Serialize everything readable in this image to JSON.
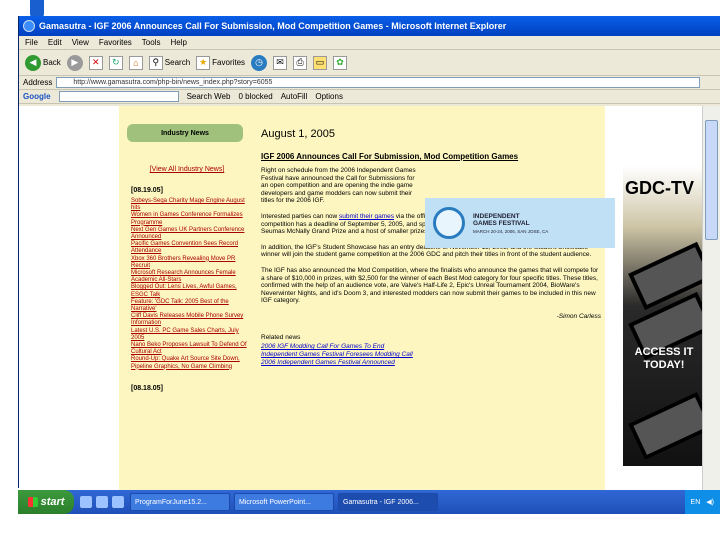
{
  "window": {
    "title": "Gamasutra - IGF 2006 Announces Call For Submission, Mod Competition Games - Microsoft Internet Explorer"
  },
  "menu": [
    "File",
    "Edit",
    "View",
    "Favorites",
    "Tools",
    "Help"
  ],
  "toolbar": {
    "back": "Back",
    "search": "Search",
    "favorites": "Favorites"
  },
  "address": {
    "label": "Address",
    "value": "http://www.gamasutra.com/php-bin/news_index.php?story=6055"
  },
  "google": {
    "logo": "Google",
    "search_web": "Search Web",
    "blocked": "0 blocked",
    "autofill": "AutoFill",
    "options": "Options"
  },
  "sidebar": {
    "title": "Industry News",
    "view_all": "[View All Industry News]",
    "date1": "[08.19.05]",
    "items": [
      "Sobeys-Sega Charity Mage Engine August hits",
      "Women in Games Conference Formalizes Programme",
      "Next Gen Games UK Partners Conference Announced",
      "Pacific Games Convention Sees Record Attendance",
      "Xbox 360 Brothers Revealing Move PR Recruit",
      "Microsoft Research Announces Female Academic All-Stars",
      "Blogged Out: Lens Lives, Awful Games, ESGC Talk",
      "Feature: 'GDC Talk: 2005 Best of the Narrative'",
      "Cliff Davis Releases Mobile Phone Survey Information",
      "Latest U.S. PC Game Sales Charts, July 2005",
      "Nano Beko Proposes Lawsuit To Defend Of Cultural Act",
      "Round-Up: Quake Art Source Site Down, Pipeline Graphics, No Game Climbing"
    ],
    "date2": "[08.18.05]"
  },
  "article": {
    "date": "August 1, 2005",
    "headline": "IGF 2006 Announces Call For Submission, Mod Competition Games",
    "para1": "Right on schedule from the 2006 Independent Games Festival have announced the Call for Submissions for an open competition and are opening the indie game developers and game modders can now submit their titles for the 2006 IGF.",
    "para2a": "Interested parties can now ",
    "para2link": "submit their games",
    "para2b": " via the official Independent Games Festival site. The main IGF competition has a deadline of September 5, 2005, and sports a total prize pool of $50,000, including the $20,000 Seumas McNally Grand Prize and a host of smaller prizes.",
    "para3": "In addition, the IGF's Student Showcase has an entry deadline of November 15, 2005, and the Student Showcase winner will join the student game competition at the 2006 GDC and pitch their titles in front of the student audience.",
    "para4": "The IGF has also announced the Mod Competition, where the finalists who announce the games that will compete for a share of $10,000 in prizes, with $2,500 for the winner of each Best Mod category for four specific titles. These titles, confirmed with the help of an audience vote, are Valve's Half-Life 2, Epic's Unreal Tournament 2004, BioWare's Neverwinter Nights, and id's Doom 3, and interested modders can now submit their games to be included in this new IGF category.",
    "author": "-Simon Carless",
    "related_h": "Related news",
    "related": [
      "2006 IGF Modding Call For Games To End",
      "Independent Games Festival Foresees Modding Call",
      "2006 Independent Games Festival Announced"
    ]
  },
  "igf_banner": {
    "title1": "INDEPENDENT",
    "title2": "GAMES FESTIVAL",
    "sub": "MARCH 20-24, 2006, SAN JOSE, CA"
  },
  "ad": {
    "brand": "GDC-TV",
    "cta1": "ACCESS IT",
    "cta2": "TODAY!"
  },
  "taskbar": {
    "start": "start",
    "tasks": [
      "ProgramForJune15.2...",
      "Microsoft PowerPoint...",
      "Gamasutra - IGF 2006..."
    ],
    "tray_lang": "EN"
  },
  "colors": {
    "page_bg": "#fdf6c0",
    "news_box": "#9fc17b",
    "titlebar": "#0a5fe8",
    "start": "#3c9a3c"
  }
}
